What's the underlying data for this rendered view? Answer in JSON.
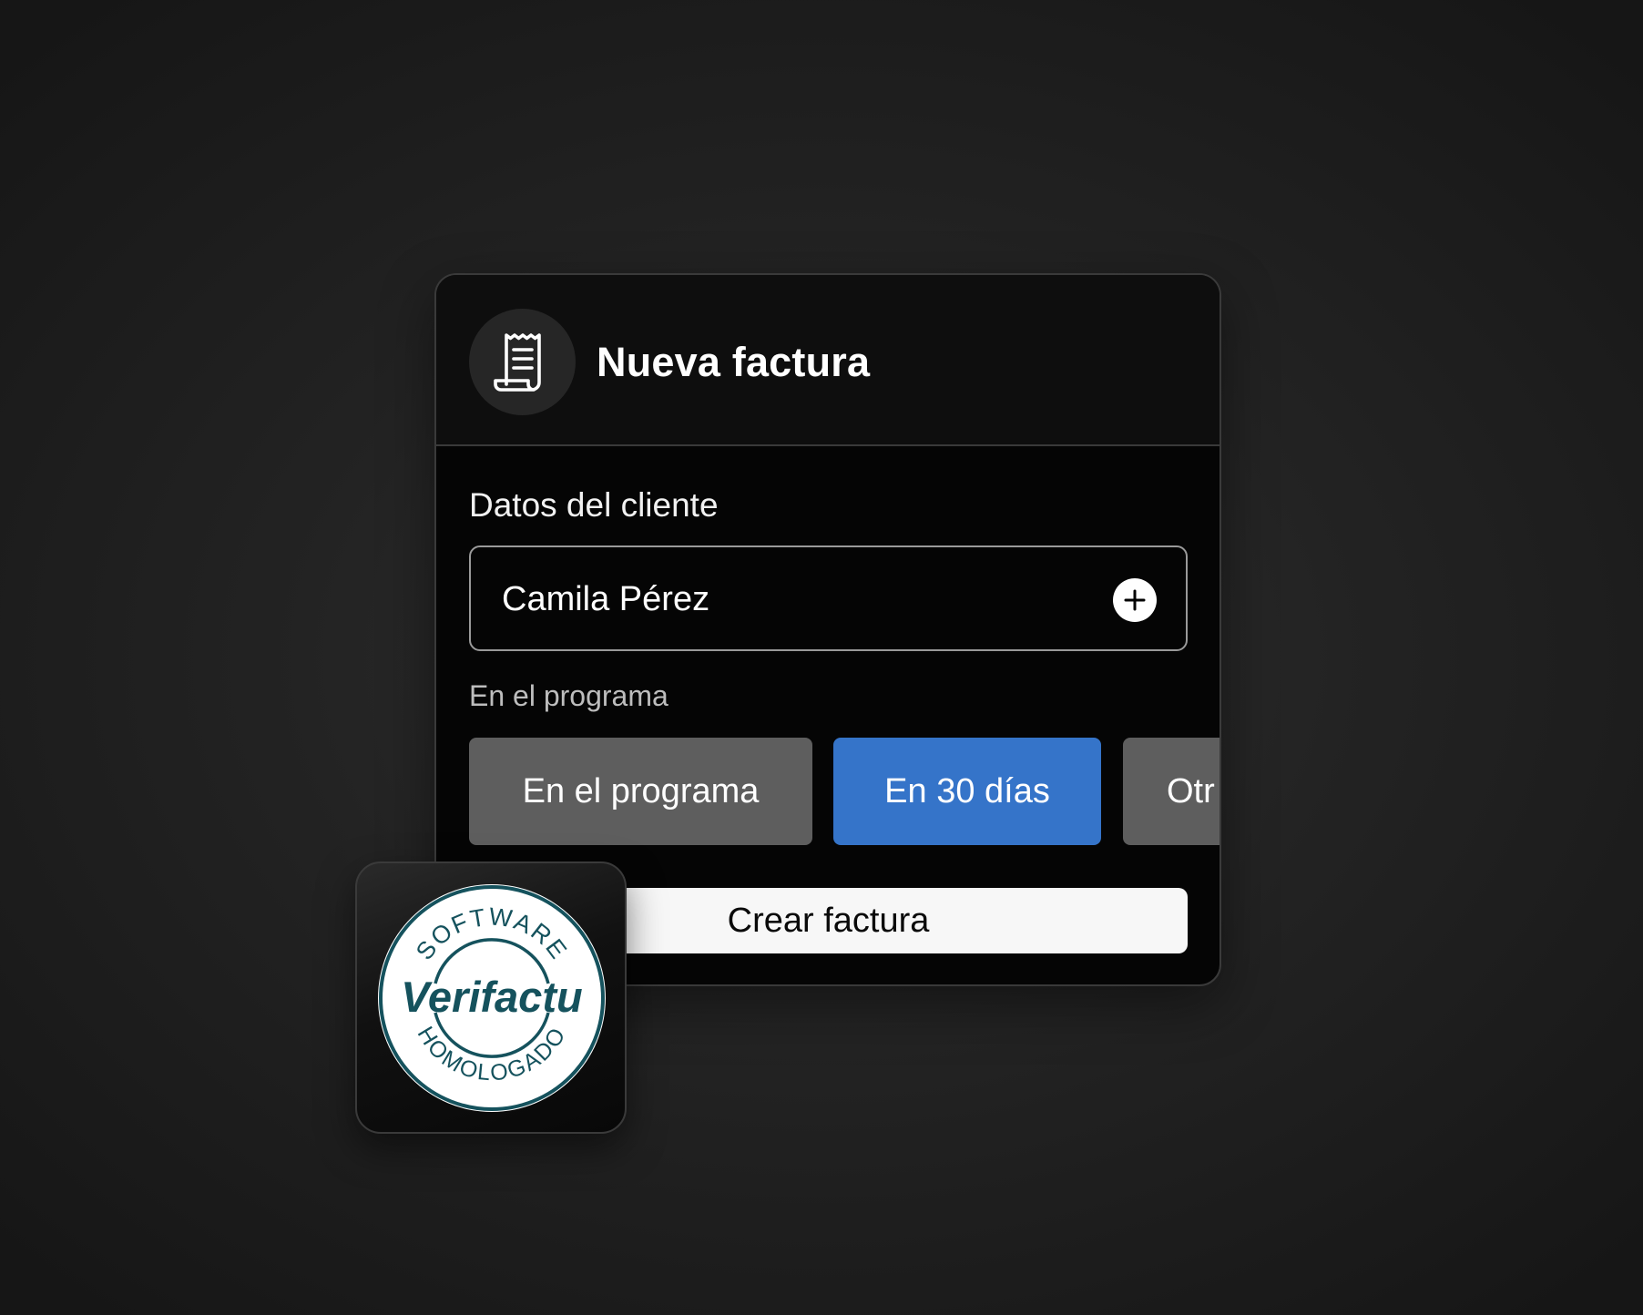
{
  "invoice_card": {
    "title": "Nueva factura",
    "header_icon": "receipt-icon",
    "client_section_label": "Datos del cliente",
    "client_name": "Camila Pérez",
    "add_icon": "plus-icon",
    "payment_label": "En el programa",
    "payment_options": [
      {
        "label": "En el programa",
        "selected": false
      },
      {
        "label": "En 30 días",
        "selected": true
      },
      {
        "label": "Otr",
        "selected": false
      }
    ],
    "create_button_label": "Crear factura"
  },
  "badge": {
    "top_text": "SOFTWARE",
    "main_text": "Verifactu",
    "bottom_text": "HOMOLOGADO",
    "color": "#15525d"
  },
  "colors": {
    "accent": "#3574c9",
    "option_bg": "#5e5e5e",
    "card_bg": "#050505"
  }
}
